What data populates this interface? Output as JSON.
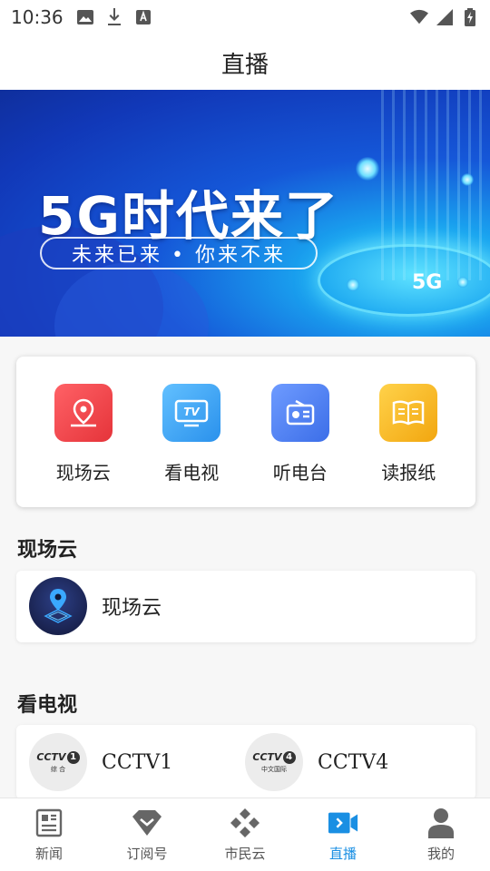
{
  "status_bar": {
    "time": "10:36"
  },
  "header": {
    "title": "直播"
  },
  "banner": {
    "headline": "5G时代来了",
    "subline": "未来已来 • 你来不来",
    "badge": "5G"
  },
  "quick_links": [
    {
      "label": "现场云",
      "icon": "location-pin-icon",
      "color": "#f0474c"
    },
    {
      "label": "看电视",
      "icon": "tv-icon",
      "color": "#3aa6f5"
    },
    {
      "label": "听电台",
      "icon": "radio-icon",
      "color": "#4d7ff0"
    },
    {
      "label": "读报纸",
      "icon": "newspaper-icon",
      "color": "#f6b620"
    }
  ],
  "scene_cloud": {
    "title": "现场云",
    "items": [
      {
        "label": "现场云"
      }
    ]
  },
  "tv": {
    "title": "看电视",
    "items": [
      {
        "label": "CCTV1",
        "logo_text": "CCTV",
        "logo_num": "1",
        "logo_sub": "综 合"
      },
      {
        "label": "CCTV4",
        "logo_text": "CCTV",
        "logo_num": "4",
        "logo_sub": "中文国际"
      }
    ]
  },
  "bottom_nav": {
    "items": [
      {
        "label": "新闻",
        "icon": "news-icon"
      },
      {
        "label": "订阅号",
        "icon": "subscribe-diamond-icon"
      },
      {
        "label": "市民云",
        "icon": "citizen-cloud-icon"
      },
      {
        "label": "直播",
        "icon": "live-video-icon",
        "active": true
      },
      {
        "label": "我的",
        "icon": "profile-icon"
      }
    ],
    "active_color": "#1a8fe3"
  }
}
